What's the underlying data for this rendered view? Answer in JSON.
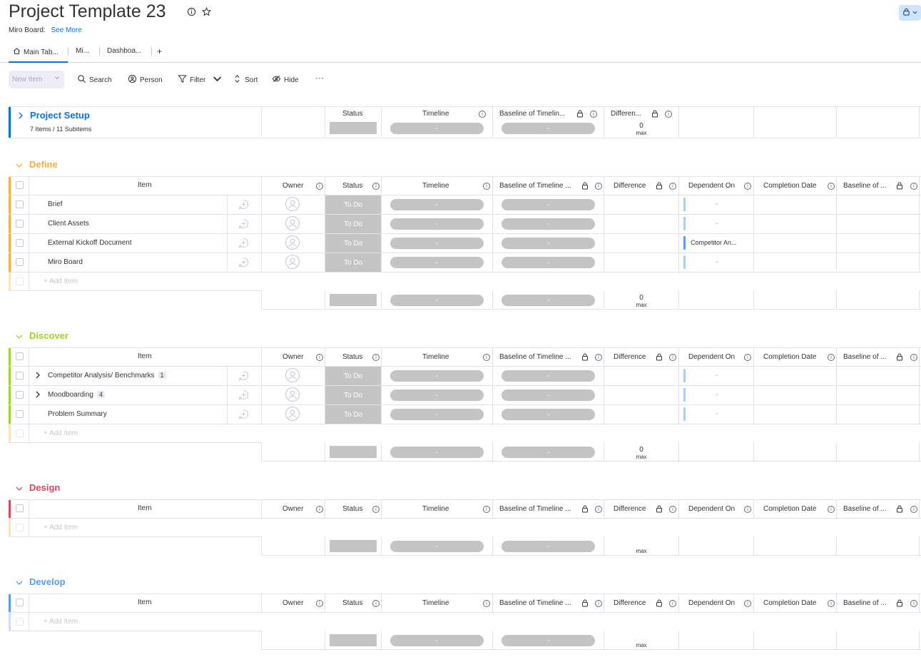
{
  "board": {
    "title": "Project Template 23",
    "miro_label": "Miro Board:",
    "see_more": "See More"
  },
  "tabs": [
    {
      "label": "Main Tab..."
    },
    {
      "label": "Mi..."
    },
    {
      "label": "Dashboa..."
    },
    {
      "label": "+"
    }
  ],
  "toolbar": {
    "new_item": "New Item",
    "search": "Search",
    "person": "Person",
    "filter": "Filter",
    "sort": "Sort",
    "hide": "Hide",
    "more": "···"
  },
  "collapsed_group": {
    "title": "Project Setup",
    "meta": "7 Items / 11 Subitems",
    "color": "#0073ea",
    "columns": {
      "status": "Status",
      "timeline": "Timeline",
      "baseline": "Baseline of Timelin...",
      "difference": "Differen...",
      "diff_value": "0",
      "diff_sub": "max"
    }
  },
  "columns": {
    "item": "Item",
    "owner": "Owner",
    "status": "Status",
    "timeline": "Timeline",
    "baseline": "Baseline of Timeline ...",
    "difference": "Difference",
    "dependent": "Dependent On",
    "completion": "Completion Date",
    "baseline_of": "Baseline of ..."
  },
  "placeholders": {
    "dash": "-",
    "add_item": "+ Add Item",
    "max": "max",
    "zero": "0"
  },
  "groups": [
    {
      "title": "Define",
      "color": "#fdab3d",
      "light_color": "#fde3c1",
      "summary_zero": "0",
      "items": [
        {
          "name": "Brief",
          "status": "To Do",
          "dependent": "-",
          "badge": ""
        },
        {
          "name": "Client Assets",
          "status": "To Do",
          "dependent": "-",
          "badge": ""
        },
        {
          "name": "External Kickoff Document",
          "status": "To Do",
          "dependent": "Competitor An...",
          "badge": ""
        },
        {
          "name": "Miro Board",
          "status": "To Do",
          "dependent": "-",
          "badge": ""
        }
      ]
    },
    {
      "title": "Discover",
      "color": "#9cd326",
      "light_color": "#fde3c1",
      "summary_zero": "0",
      "items": [
        {
          "name": "Competitor Analysis/ Benchmarks",
          "status": "To Do",
          "dependent": "-",
          "badge": "1"
        },
        {
          "name": "Moodboarding",
          "status": "To Do",
          "dependent": "-",
          "badge": "4"
        },
        {
          "name": "Problem Summary",
          "status": "To Do",
          "dependent": "-",
          "badge": ""
        }
      ]
    },
    {
      "title": "Design",
      "color": "#e2445c",
      "light_color": "#fde3c1",
      "summary_zero": "",
      "items": []
    },
    {
      "title": "Develop",
      "color": "#579bfc",
      "light_color": "#cce0fd",
      "summary_zero": "",
      "items": []
    }
  ]
}
